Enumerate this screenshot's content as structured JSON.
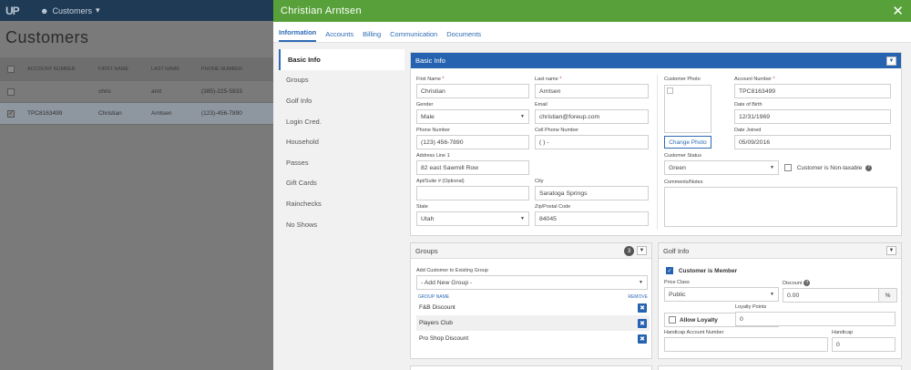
{
  "background": {
    "logo": "UP",
    "nav_label": "Customers",
    "page_title": "Customers",
    "columns": [
      "ACCOUNT NUMBER",
      "FIRST NAME",
      "LAST NAME",
      "PHONE NUMBER"
    ],
    "rows": [
      {
        "account": "",
        "first": "chris",
        "last": "arnt",
        "phone": "(385)-225-5933",
        "checked": false
      },
      {
        "account": "TPC8163499",
        "first": "Christian",
        "last": "Arntsen",
        "phone": "(123)-456-7890",
        "checked": true
      }
    ]
  },
  "modal": {
    "title": "Christian Arntsen",
    "tabs": [
      "Information",
      "Accounts",
      "Billing",
      "Communication",
      "Documents"
    ],
    "active_tab": "Information"
  },
  "sidenav": [
    "Basic Info",
    "Groups",
    "Golf Info",
    "Login Cred.",
    "Household",
    "Passes",
    "Gift Cards",
    "Rainchecks",
    "No Shows"
  ],
  "basic_info": {
    "title": "Basic Info",
    "first_name": {
      "label": "First Name",
      "value": "Christian"
    },
    "last_name": {
      "label": "Last name",
      "value": "Arntsen"
    },
    "gender": {
      "label": "Gender",
      "value": "Male"
    },
    "email": {
      "label": "Email",
      "value": "christian@foreup.com"
    },
    "phone": {
      "label": "Phone Number",
      "value": "(123) 456-7890"
    },
    "cell": {
      "label": "Cell Phone Number",
      "value": "(  )   -"
    },
    "address1": {
      "label": "Address Line 1",
      "value": "82 east Sawmill Row"
    },
    "apt": {
      "label": "Apt/Suite # (Optional)",
      "value": ""
    },
    "city": {
      "label": "City",
      "value": "Saratoga Springs"
    },
    "state": {
      "label": "State",
      "value": "Utah"
    },
    "zip": {
      "label": "Zip/Postal Code",
      "value": "84045"
    },
    "photo_label": "Customer Photo",
    "change_photo": "Change Photo",
    "account_number": {
      "label": "Account Number",
      "value": "TPC8163499"
    },
    "dob": {
      "label": "Date of Birth",
      "value": "12/31/1969"
    },
    "date_joined": {
      "label": "Date Joined",
      "value": "05/09/2016"
    },
    "status": {
      "label": "Customer Status",
      "value": "Green"
    },
    "non_taxable": "Customer is Non-taxable",
    "notes_label": "Comments/Notes"
  },
  "groups": {
    "title": "Groups",
    "count": "3",
    "add_label": "Add Customer to Existing Group",
    "add_placeholder": "- Add New Group -",
    "col_name": "GROUP NAME",
    "col_remove": "REMOVE",
    "items": [
      "F&B Discount",
      "Players Club",
      "Pro Shop Discount"
    ]
  },
  "golf_info": {
    "title": "Golf Info",
    "is_member": "Customer is Member",
    "price_class": {
      "label": "Price Class",
      "value": "Public"
    },
    "discount": {
      "label": "Discount",
      "value": "0.00",
      "suffix": "%"
    },
    "allow_loyalty": "Allow Loyalty",
    "loyalty_points": {
      "label": "Loyalty Points",
      "value": "0"
    },
    "handicap_account": {
      "label": "Handicap Account Number",
      "value": ""
    },
    "handicap": {
      "label": "Handicap",
      "value": "0"
    }
  },
  "colors": {
    "header_green": "#58a13a",
    "accent_blue": "#2563b0"
  }
}
